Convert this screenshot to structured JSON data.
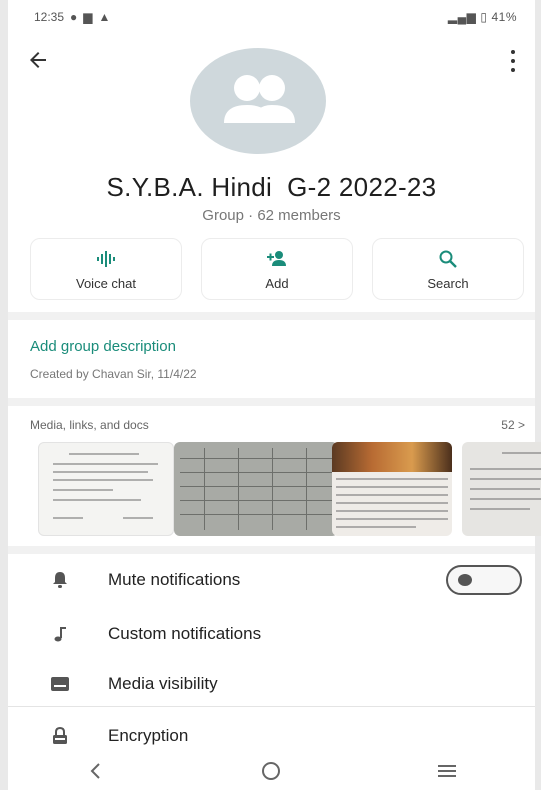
{
  "status_bar": {
    "time": "12:35",
    "right_text": "ℝ ℝ⁴⁸ ⁴ⁱˡ ⁴ⁱˡ",
    "battery": "41%"
  },
  "header": {
    "group_name": "S.Y.B.A. Hindi  G-2 2022-23",
    "group_meta": "Group · 62 members"
  },
  "actions": [
    {
      "label": "Voice chat",
      "icon": "voice-wave-icon"
    },
    {
      "label": "Add",
      "icon": "add-person-icon"
    },
    {
      "label": "Search",
      "icon": "search-icon"
    }
  ],
  "description": {
    "add_label": "Add group description",
    "created_by": "Created by Chavan Sir, 11/4/22"
  },
  "media": {
    "title": "Media, links, and docs",
    "count": "52 >"
  },
  "settings": [
    {
      "label": "Mute notifications",
      "icon": "bell-icon"
    },
    {
      "label": "Custom notifications",
      "icon": "music-note-icon"
    },
    {
      "label": "Media visibility",
      "icon": "image-icon"
    },
    {
      "label": "Encryption",
      "icon": "lock-icon"
    }
  ],
  "toggle_state": false,
  "colors": {
    "accent": "#1a8c7a",
    "avatar_bg": "#cfd8dc"
  }
}
